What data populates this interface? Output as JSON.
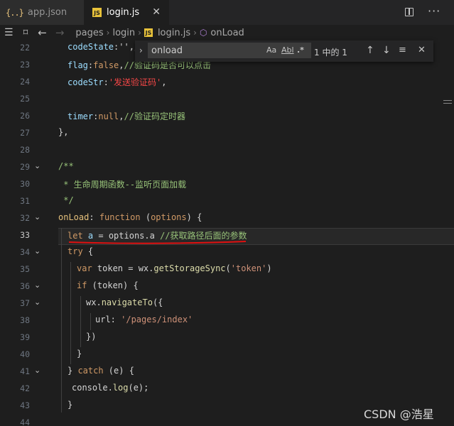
{
  "tabs": [
    {
      "icon": "{..}",
      "label": "app.json"
    },
    {
      "icon": "JS",
      "label": "login.js"
    }
  ],
  "breadcrumb": [
    "pages",
    "login",
    "login.js",
    "onLoad"
  ],
  "find": {
    "query": "onload",
    "opt_case": "Aa",
    "opt_word": "Abl",
    "opt_regex": ".*",
    "count": "1 中的 1"
  },
  "lines": [
    {
      "n": "22",
      "code": [
        [
          "p",
          "codeState"
        ],
        [
          "v",
          ":''"
        ],
        [
          "v",
          ",//..."
        ]
      ]
    },
    {
      "n": "23",
      "code": [
        [
          "p",
          "flag"
        ],
        [
          "v",
          ":"
        ],
        [
          "k",
          "false"
        ],
        [
          "v",
          ","
        ],
        [
          "cg",
          "//验证码是否可以点击"
        ]
      ]
    },
    {
      "n": "24",
      "code": [
        [
          "p",
          "codeStr"
        ],
        [
          "v",
          ":"
        ],
        [
          "sr",
          "'发送验证码'"
        ],
        [
          "v",
          ","
        ]
      ]
    },
    {
      "n": "25",
      "code": []
    },
    {
      "n": "26",
      "code": [
        [
          "p",
          "timer"
        ],
        [
          "v",
          ":"
        ],
        [
          "k",
          "null"
        ],
        [
          "v",
          ","
        ],
        [
          "cg",
          "//验证码定时器"
        ]
      ]
    },
    {
      "n": "27",
      "code": [
        [
          "v",
          "},"
        ]
      ]
    },
    {
      "n": "28",
      "code": []
    },
    {
      "n": "29",
      "code": [
        [
          "cg",
          "/**"
        ]
      ]
    },
    {
      "n": "30",
      "code": [
        [
          "cg",
          " * 生命周期函数--监听页面加载"
        ]
      ]
    },
    {
      "n": "31",
      "code": [
        [
          "cg",
          " */"
        ]
      ]
    },
    {
      "n": "32",
      "code": [
        [
          "fn",
          "onLoad"
        ],
        [
          "v",
          ": "
        ],
        [
          "kb",
          "function"
        ],
        [
          "v",
          " ("
        ],
        [
          "b",
          "options"
        ],
        [
          "v",
          ") {"
        ]
      ]
    },
    {
      "n": "33",
      "code": [
        [
          "kb",
          "let"
        ],
        [
          "v",
          " "
        ],
        [
          "p",
          "a"
        ],
        [
          "v",
          " = options.a "
        ],
        [
          "cg",
          "//获取路径后面的参数"
        ]
      ]
    },
    {
      "n": "34",
      "code": [
        [
          "kb",
          "try"
        ],
        [
          "v",
          " {"
        ]
      ]
    },
    {
      "n": "35",
      "code": [
        [
          "kb",
          "var"
        ],
        [
          "v",
          " token = wx."
        ],
        [
          "f",
          "getStorageSync"
        ],
        [
          "v",
          "("
        ],
        [
          "s",
          "'token'"
        ],
        [
          "v",
          ")"
        ]
      ]
    },
    {
      "n": "36",
      "code": [
        [
          "kb",
          "if"
        ],
        [
          "v",
          " (token) {"
        ]
      ]
    },
    {
      "n": "37",
      "code": [
        [
          "v",
          "wx."
        ],
        [
          "f",
          "navigateTo"
        ],
        [
          "v",
          "({"
        ]
      ]
    },
    {
      "n": "38",
      "code": [
        [
          "v",
          "url: "
        ],
        [
          "s",
          "'/pages/index'"
        ]
      ]
    },
    {
      "n": "39",
      "code": [
        [
          "v",
          "})"
        ]
      ]
    },
    {
      "n": "40",
      "code": [
        [
          "v",
          "}"
        ]
      ]
    },
    {
      "n": "41",
      "code": [
        [
          "v",
          "} "
        ],
        [
          "kb",
          "catch"
        ],
        [
          "v",
          " (e) {"
        ]
      ]
    },
    {
      "n": "42",
      "code": [
        [
          "v",
          "console."
        ],
        [
          "f",
          "log"
        ],
        [
          "v",
          "(e);"
        ]
      ]
    },
    {
      "n": "43",
      "code": [
        [
          "v",
          "}"
        ]
      ]
    },
    {
      "n": "44",
      "code": []
    }
  ],
  "watermark": "CSDN @浩星"
}
